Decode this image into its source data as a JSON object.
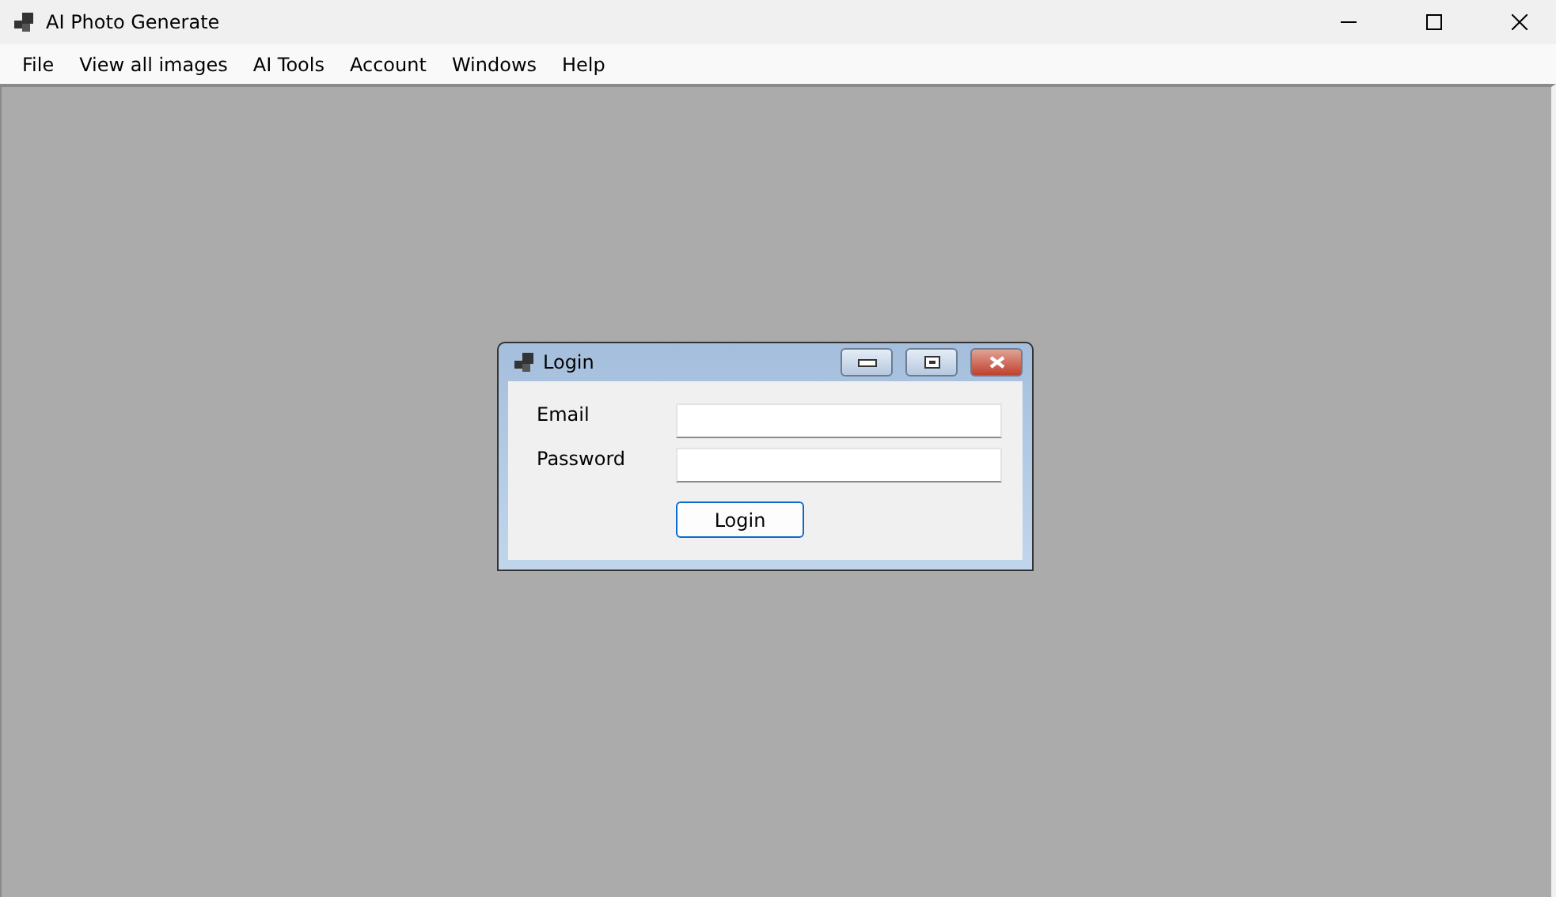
{
  "window": {
    "title": "AI Photo Generate"
  },
  "menu": [
    "File",
    "View all images",
    "AI Tools",
    "Account",
    "Windows",
    "Help"
  ],
  "login_window": {
    "title": "Login",
    "fields": [
      {
        "label": "Email"
      },
      {
        "label": "Password"
      }
    ],
    "button": "Login"
  }
}
